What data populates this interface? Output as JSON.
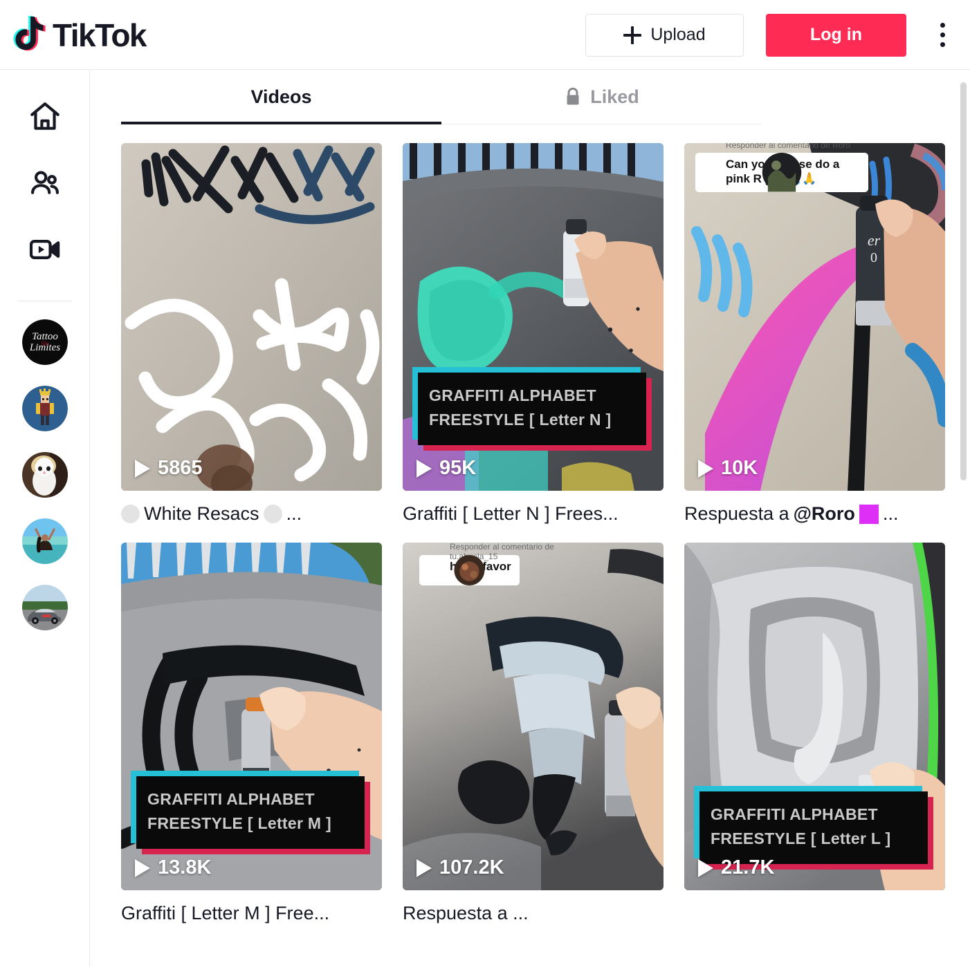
{
  "header": {
    "logo_text": "TikTok",
    "logo_icon": "tiktok-note-icon",
    "upload_label": "Upload",
    "upload_icon": "plus-icon",
    "login_label": "Log in",
    "more_icon": "kebab-menu-icon",
    "accent_color": "#fe2c55"
  },
  "sidebar": {
    "nav": [
      {
        "icon": "home-icon",
        "name": "for-you"
      },
      {
        "icon": "people-icon",
        "name": "following"
      },
      {
        "icon": "live-video-icon",
        "name": "live"
      }
    ],
    "suggested_accounts": [
      {
        "icon": "tattoo-sin-limites-avatar",
        "label": "Tattoo Sin Limites"
      },
      {
        "icon": "minecraft-king-avatar",
        "label": "Minecraft King"
      },
      {
        "icon": "white-owl-avatar",
        "label": "White Owl"
      },
      {
        "icon": "beach-person-avatar",
        "label": "Beach Person"
      },
      {
        "icon": "sports-car-avatar",
        "label": "Sports Car"
      }
    ]
  },
  "tabs": [
    {
      "label": "Videos",
      "active": true,
      "icon": null
    },
    {
      "label": "Liked",
      "active": false,
      "icon": "lock-icon"
    }
  ],
  "videos": [
    {
      "views": "5865",
      "caption_prefix": "",
      "caption": "White Resacs",
      "caption_suffix": "...",
      "caption_emoji_lead": "circle",
      "caption_emoji_trail": "circle",
      "overlay_title": null,
      "sticker": null
    },
    {
      "views": "95K",
      "caption": "Graffiti [ Letter N ] Frees...",
      "overlay_title": {
        "line1": "GRAFFITI ALPHABET",
        "line2": "FREESTYLE [ Letter N ]"
      },
      "sticker": null
    },
    {
      "views": "10K",
      "caption": "Respuesta a ",
      "mention": "@Roro",
      "caption_suffix": "...",
      "caption_emoji_trail": "square",
      "overlay_title": null,
      "sticker": {
        "header": "Responder al comentario de Roro",
        "text": "Can you please do a pink R plzz🙏🙏"
      }
    },
    {
      "views": "13.8K",
      "caption": "Graffiti [ Letter M ] Free...",
      "overlay_title": {
        "line1": "GRAFFITI ALPHABET",
        "line2": "FREESTYLE [ Letter M ]"
      },
      "sticker": null
    },
    {
      "views": "107.2K",
      "caption": "Respuesta a ...",
      "overlay_title": null,
      "sticker": {
        "header": "Responder al comentario de tu.abuela_15",
        "text": "h por favor"
      }
    },
    {
      "views": "21.7K",
      "caption": "",
      "overlay_title": {
        "line1": "GRAFFITI ALPHABET",
        "line2": "FREESTYLE [ Letter L ]"
      },
      "sticker": null
    }
  ],
  "colors": {
    "overlay_cyan": "#25c0d5",
    "overlay_pink": "#d6234f",
    "overlay_bg": "#0a0a0a",
    "tab_active": "#161823",
    "tab_inactive": "#999aa0"
  }
}
